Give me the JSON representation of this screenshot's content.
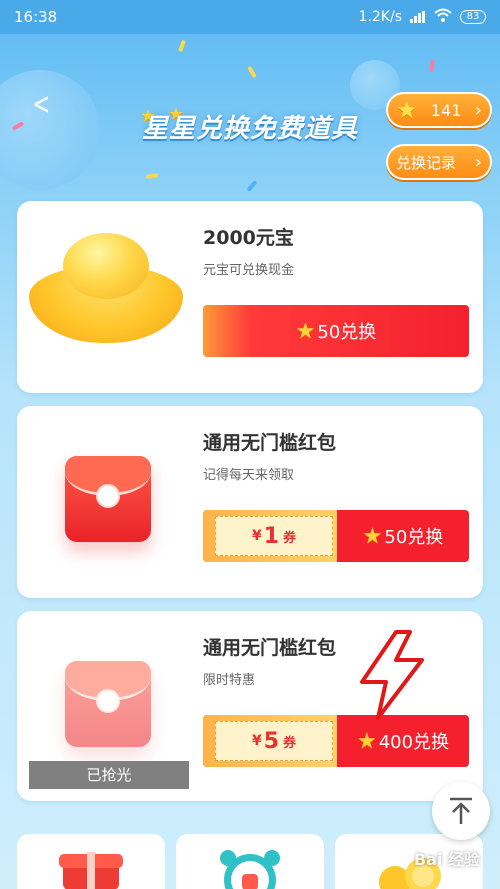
{
  "status_bar": {
    "time": "16:38",
    "network_speed": "1.2K/s",
    "battery": "83"
  },
  "header": {
    "title": "星星兑换免费道具",
    "star_count": "141",
    "history_label": "兑换记录"
  },
  "items": [
    {
      "title": "2000元宝",
      "subtitle": "元宝可兑换现金",
      "button_label": "50兑换"
    },
    {
      "title": "通用无门槛红包",
      "subtitle": "记得每天来领取",
      "coupon_currency": "¥",
      "coupon_value": "1",
      "coupon_unit": "券",
      "button_label": "50兑换"
    },
    {
      "title": "通用无门槛红包",
      "subtitle": "限时特惠",
      "coupon_currency": "¥",
      "coupon_value": "5",
      "coupon_unit": "券",
      "button_label": "400兑换",
      "status": "已抢光"
    }
  ],
  "watermark": "Bai 经验",
  "colors": {
    "accent_red": "#f4202e",
    "accent_orange": "#ff8a12",
    "star_gold": "#ffd13a"
  },
  "icons": {
    "back": "back-chevron-icon",
    "star": "star-icon",
    "chevron": "chevron-right-icon",
    "back_to_top": "arrow-up-icon"
  }
}
